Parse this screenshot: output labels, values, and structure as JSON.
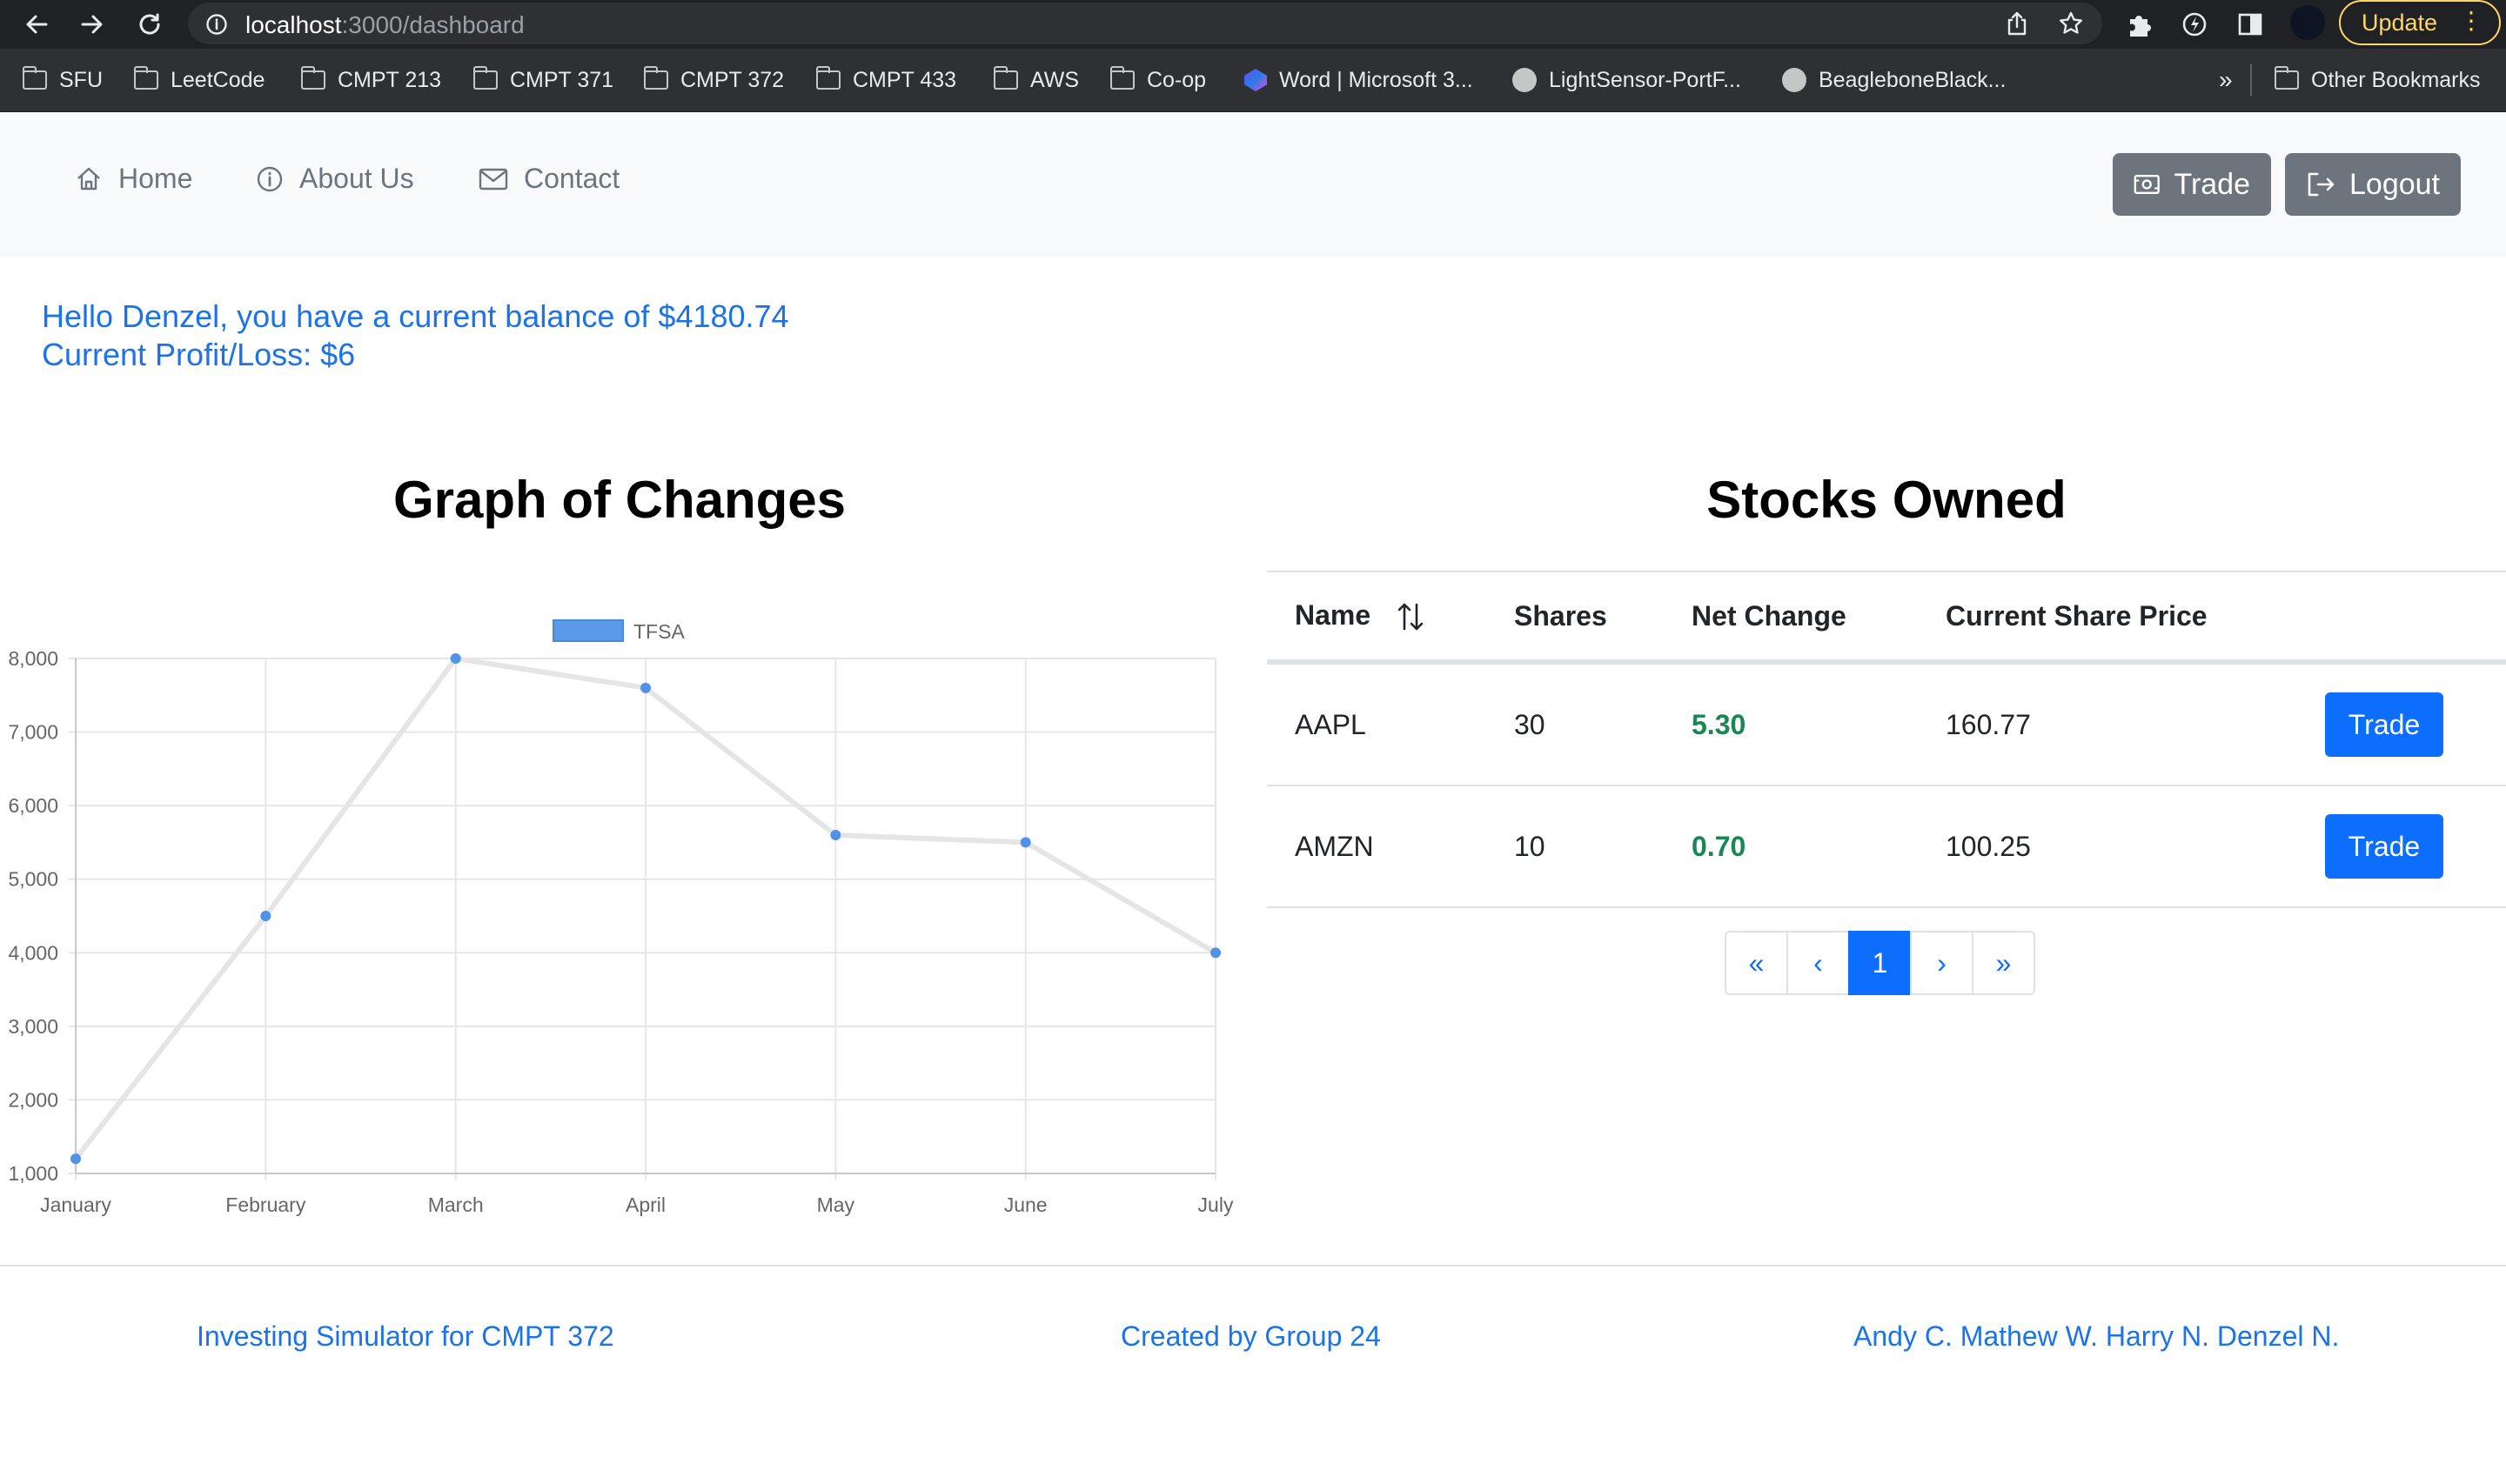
{
  "browser": {
    "url_host": "localhost",
    "url_path": ":3000/dashboard",
    "update_label": "Update",
    "bookmarks": [
      "SFU",
      "LeetCode",
      "CMPT 213",
      "CMPT 371",
      "CMPT 372",
      "CMPT 433",
      "AWS",
      "Co-op",
      "Word | Microsoft 3...",
      "LightSensor-PortF...",
      "BeagleboneBlack..."
    ],
    "overflow": "»",
    "other_bookmarks": "Other Bookmarks"
  },
  "nav": {
    "home": "Home",
    "about": "About Us",
    "contact": "Contact",
    "trade": "Trade",
    "logout": "Logout"
  },
  "greeting": {
    "line1": "Hello Denzel, you have a current balance of $4180.74",
    "line2": "Current Profit/Loss: $6"
  },
  "graph": {
    "title": "Graph of Changes"
  },
  "chart_data": {
    "type": "line",
    "categories": [
      "January",
      "February",
      "March",
      "April",
      "May",
      "June",
      "July"
    ],
    "series": [
      {
        "name": "TFSA",
        "values": [
          1200,
          4500,
          8000,
          7600,
          5600,
          5500,
          4000
        ]
      }
    ],
    "ylim": [
      1000,
      8000
    ],
    "yticks": [
      "1,000",
      "2,000",
      "3,000",
      "4,000",
      "5,000",
      "6,000",
      "7,000",
      "8,000"
    ],
    "grid": true,
    "legend": "top",
    "colors": {
      "line": "#e5e5e5",
      "point": "#4f93e8",
      "legend_fill": "#5b9ae8"
    }
  },
  "stocks": {
    "title": "Stocks Owned",
    "headers": {
      "name": "Name",
      "shares": "Shares",
      "net": "Net Change",
      "price": "Current Share Price"
    },
    "rows": [
      {
        "name": "AAPL",
        "shares": "30",
        "net": "5.30",
        "price": "160.77",
        "action": "Trade"
      },
      {
        "name": "AMZN",
        "shares": "10",
        "net": "0.70",
        "price": "100.25",
        "action": "Trade"
      }
    ],
    "pager": {
      "first": "«",
      "prev": "‹",
      "page": "1",
      "next": "›",
      "last": "»"
    }
  },
  "footer": {
    "left": "Investing Simulator for CMPT 372",
    "center": "Created by Group 24",
    "right": "Andy C. Mathew W. Harry N. Denzel N."
  }
}
